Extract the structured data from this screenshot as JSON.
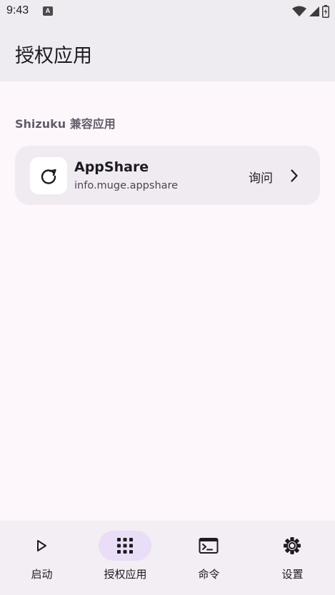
{
  "status_bar": {
    "time": "9:43",
    "notification_glyph": "A",
    "icons": [
      "wifi-icon",
      "signal-icon",
      "battery-icon"
    ]
  },
  "header": {
    "title": "授权应用"
  },
  "section": {
    "label": "Shizuku 兼容应用"
  },
  "app": {
    "name": "AppShare",
    "package": "info.muge.appshare",
    "mode": "询问",
    "icon": "refresh-icon"
  },
  "bottom_nav": {
    "items": [
      {
        "label": "启动",
        "icon": "play-icon",
        "active": false
      },
      {
        "label": "授权应用",
        "icon": "grid-icon",
        "active": true
      },
      {
        "label": "命令",
        "icon": "terminal-icon",
        "active": false
      },
      {
        "label": "设置",
        "icon": "gear-icon",
        "active": false
      }
    ]
  },
  "colors": {
    "background": "#fdf7fc",
    "app_bar": "#efecf1",
    "card": "#f0ebf1",
    "active_indicator": "#e9ddf8"
  }
}
